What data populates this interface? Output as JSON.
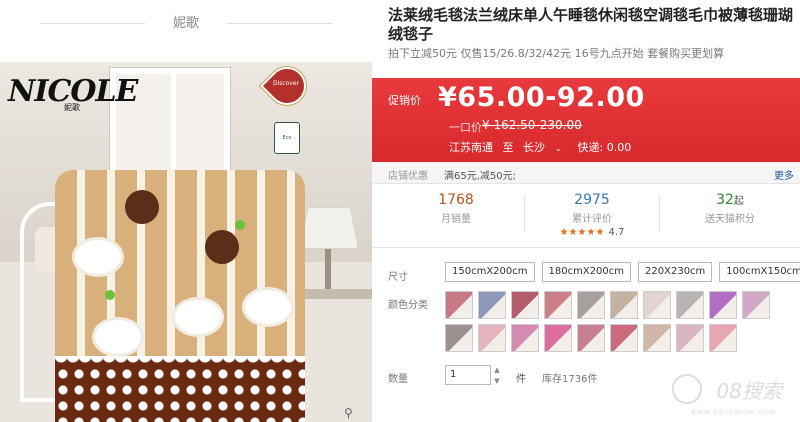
{
  "brand": {
    "top_label": "妮歌",
    "logo_text": "NICOLE",
    "logo_sub": "妮歌"
  },
  "image_badges": {
    "heart": "Discover",
    "tag": "Eco"
  },
  "zoom_icon": "magnifier-icon",
  "product": {
    "title": "法莱绒毛毯法兰绒床单人午睡毯休闲毯空调毯毛巾被薄毯珊瑚绒毯子",
    "subtitle": "拍下立减50元 仅售15/26.8/32/42元 16号九点开始 套餐购买更划算"
  },
  "price": {
    "label": "促销价",
    "value": "¥65.00-92.00",
    "orig_label": "一口价",
    "orig_value": "¥ 162.50-230.00",
    "ship_from": "江苏南通",
    "ship_to_word": "至",
    "ship_to": "长沙",
    "ship_fee": "快递: 0.00"
  },
  "promo": {
    "label": "店铺优惠",
    "text": "满65元,减50元;",
    "more": "更多"
  },
  "stats": [
    {
      "num": "1768",
      "label": "月销量"
    },
    {
      "num": "2975",
      "label": "累计评价",
      "stars": "★★★★★",
      "rating": "4.7"
    },
    {
      "num": "32",
      "num_suffix": "起",
      "label": "送天猫积分"
    }
  ],
  "options": {
    "size_label": "尺寸",
    "sizes": [
      "150cmX200cm",
      "180cmX200cm",
      "220X230cm",
      "100cmX150cm"
    ],
    "color_label": "颜色分类",
    "swatch_colors": [
      "#c77a86",
      "#8e98b8",
      "#b25c6c",
      "#cd7f87",
      "#a7a09c",
      "#c4b2a0",
      "#e0d3d0",
      "#b9b3b3",
      "#b26ec4",
      "#cfa8c6",
      "#9c9090",
      "#e4b5be",
      "#d48ab2",
      "#de6d9f",
      "#c67f93",
      "#c86c7c",
      "#d0b7a9",
      "#dab5c0",
      "#e7a7b0"
    ]
  },
  "quantity": {
    "label": "数量",
    "value": "1",
    "unit": "件",
    "stock": "库存1736件"
  },
  "watermark": {
    "text": "08搜索",
    "sub": "www.08sousuo.com"
  }
}
